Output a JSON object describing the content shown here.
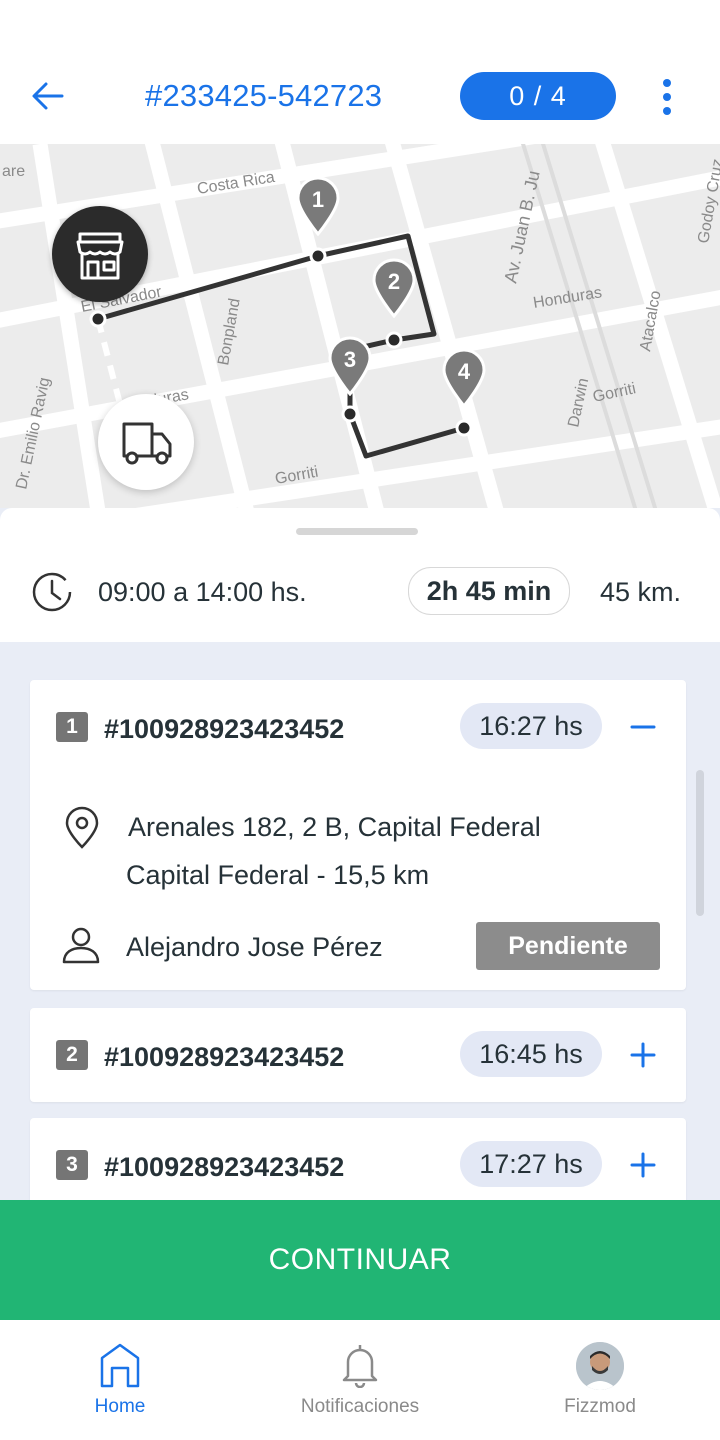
{
  "header": {
    "order_id": "#233425-542723",
    "progress": "0 / 4",
    "icons": [
      "arrow-left-icon",
      "more-vertical-icon"
    ]
  },
  "map": {
    "streets": [
      "Costa Rica",
      "El Salvador",
      "Bonpland",
      "Honduras",
      "Av. Juan B. Ju",
      "Honduras",
      "Atacalco",
      "Godoy Cruz",
      "Gorriti",
      "Darwin",
      "Gorriti",
      "Dr. Emilio Ravig",
      "duras",
      "are"
    ],
    "markers": [
      "1",
      "2",
      "3",
      "4"
    ],
    "icons": [
      "store-icon",
      "truck-icon"
    ]
  },
  "summary": {
    "time_window": "09:00 a 14:00 hs.",
    "duration": "2h 45 min",
    "distance": "45 km."
  },
  "stops": [
    {
      "number": "1",
      "code": "#100928923423452",
      "eta": "16:27 hs",
      "expanded": true,
      "address_line1": "Arenales 182, 2 B, Capital Federal",
      "address_line2": "Capital Federal  - 15,5 km",
      "recipient": "Alejandro Jose Pérez",
      "status": "Pendiente"
    },
    {
      "number": "2",
      "code": "#100928923423452",
      "eta": "16:45 hs",
      "expanded": false
    },
    {
      "number": "3",
      "code": "#100928923423452",
      "eta": "17:27 hs",
      "expanded": false
    }
  ],
  "cta": {
    "label": "CONTINUAR"
  },
  "nav": {
    "items": [
      {
        "label": "Home",
        "active": true
      },
      {
        "label": "Notificaciones",
        "active": false
      },
      {
        "label": "Fizzmod",
        "active": false
      }
    ]
  },
  "colors": {
    "accent": "#1a73e8",
    "cta": "#21b574",
    "status_pending": "#8c8c8c"
  }
}
